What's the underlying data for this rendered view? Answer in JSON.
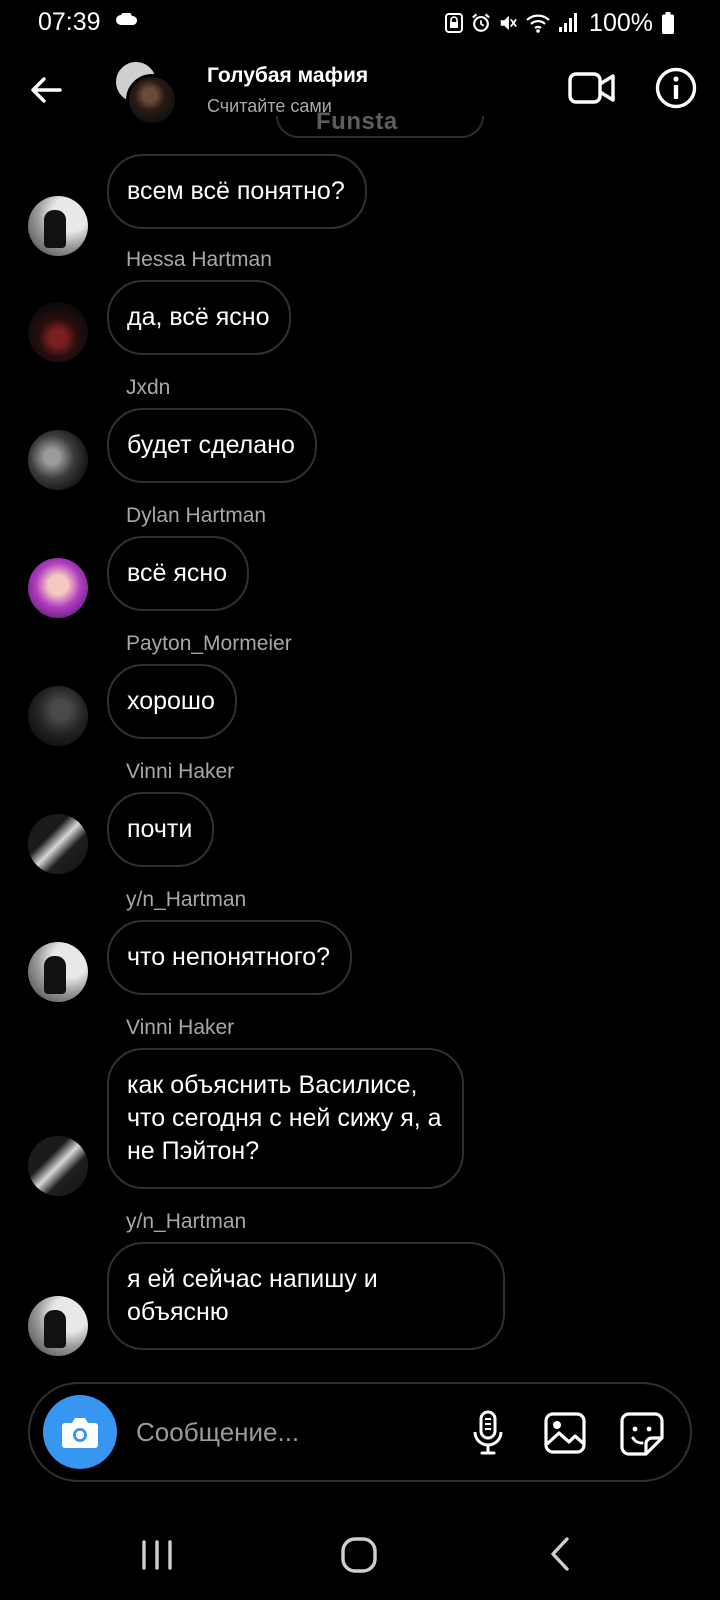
{
  "status_bar": {
    "time": "07:39",
    "battery": "100%",
    "icons": [
      "cloud-icon",
      "lock-icon",
      "alarm-icon",
      "mute-icon",
      "wifi-icon",
      "signal-icon",
      "battery-icon"
    ]
  },
  "header": {
    "title": "Голубая мафия",
    "subtitle": "Считайте сами",
    "watermark": "Funsta"
  },
  "messages": [
    {
      "sender": "",
      "text": "всем всё понятно?",
      "avatar": "ghost"
    },
    {
      "sender": "Hessa  Hartman",
      "text": "да, всё ясно",
      "avatar": "dark-red"
    },
    {
      "sender": "Jxdn",
      "text": "будет сделано",
      "avatar": "mono"
    },
    {
      "sender": "Dylan Hartman",
      "text": "всё ясно",
      "avatar": "purple"
    },
    {
      "sender": "Payton_Mormeier",
      "text": "хорошо",
      "avatar": "dim"
    },
    {
      "sender": "Vinni Haker",
      "text": "почти",
      "avatar": "bw"
    },
    {
      "sender": "y/n_Hartman",
      "text": "что непонятного?",
      "avatar": "ghost"
    },
    {
      "sender": "Vinni Haker",
      "text": "как объяснить Василисе,\nчто сегодня с ней сижу я, а\nне Пэйтон?",
      "avatar": "bw"
    },
    {
      "sender": "y/n_Hartman",
      "text": "я ей сейчас напишу и\nобъясню",
      "avatar": "ghost"
    }
  ],
  "composer": {
    "placeholder": "Сообщение..."
  },
  "colors": {
    "background": "#000000",
    "bubble_border": "#303030",
    "camera_button": "#3797f0",
    "secondary_text": "#a8a8a8"
  }
}
